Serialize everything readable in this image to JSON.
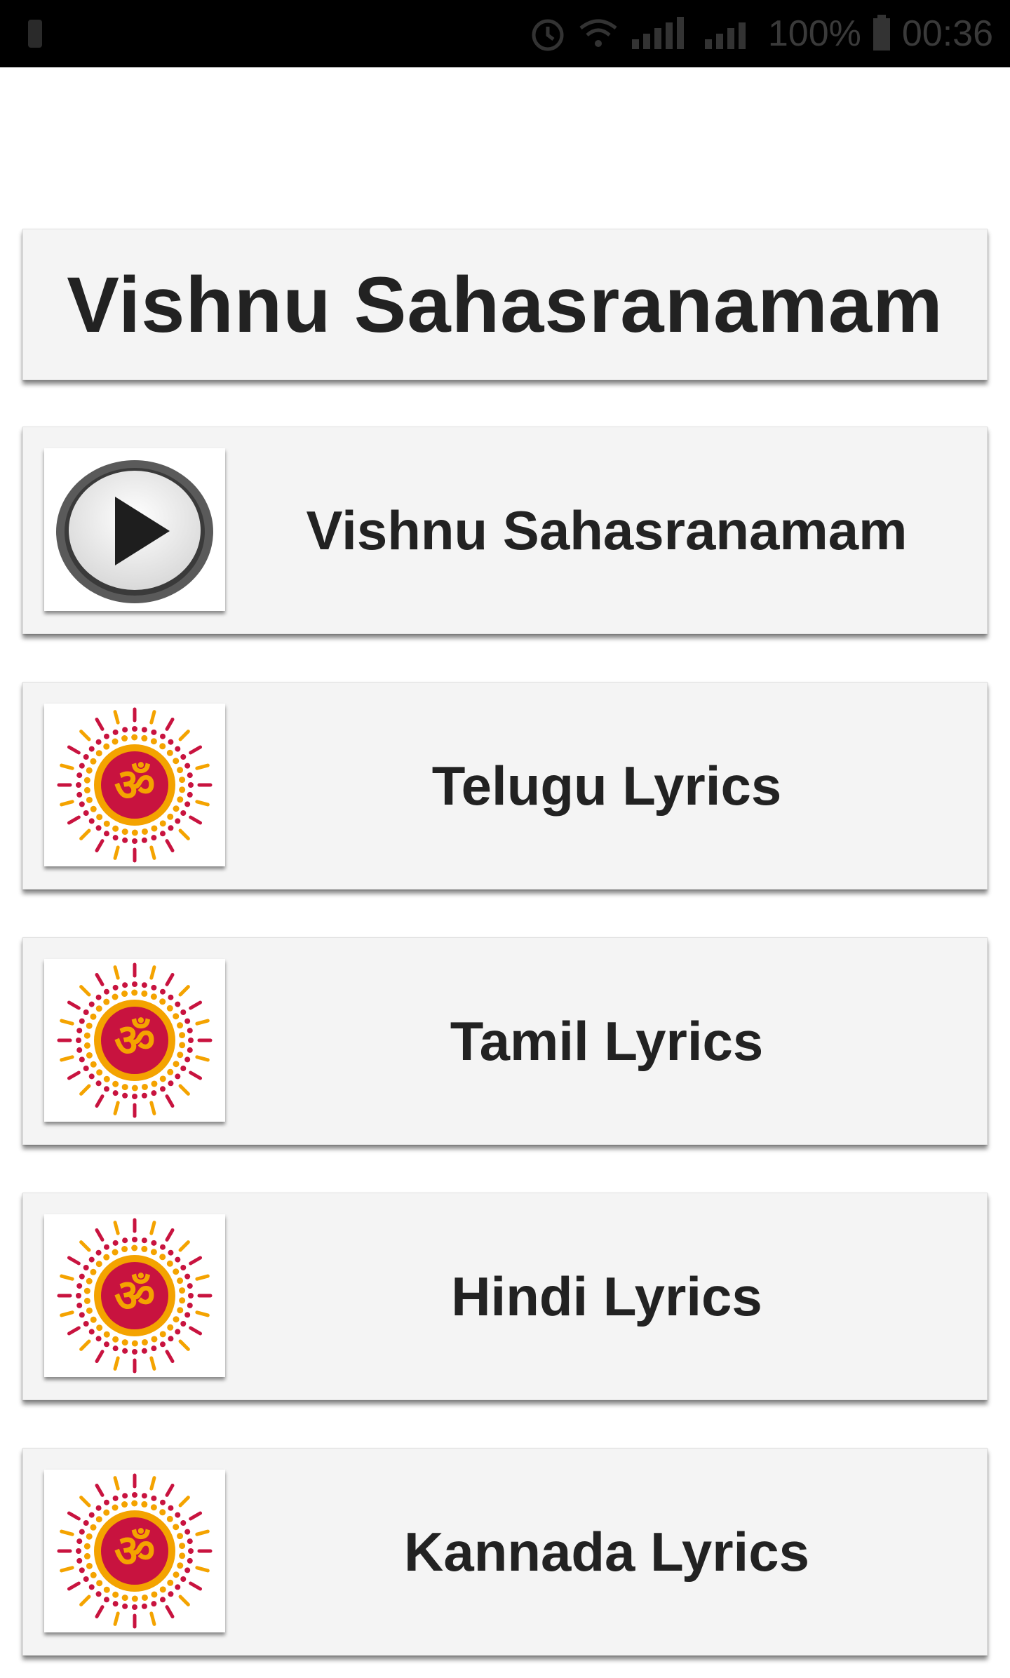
{
  "status_bar": {
    "battery": "100%",
    "time": "00:36",
    "icons": [
      "alarm-icon",
      "wifi-icon",
      "signal-icon",
      "signal-icon",
      "battery-icon"
    ]
  },
  "header": {
    "title": "Vishnu Sahasranamam"
  },
  "items": [
    {
      "label": "Vishnu Sahasranamam",
      "icon": "play-icon"
    },
    {
      "label": "Telugu Lyrics",
      "icon": "om-mandala-icon"
    },
    {
      "label": "Tamil Lyrics",
      "icon": "om-mandala-icon"
    },
    {
      "label": "Hindi Lyrics",
      "icon": "om-mandala-icon"
    },
    {
      "label": "Kannada Lyrics",
      "icon": "om-mandala-icon"
    }
  ],
  "colors": {
    "card_background": "#f4f4f4",
    "text": "#222222",
    "om_circle": "#c8133f",
    "om_ring": "#f4a300"
  }
}
